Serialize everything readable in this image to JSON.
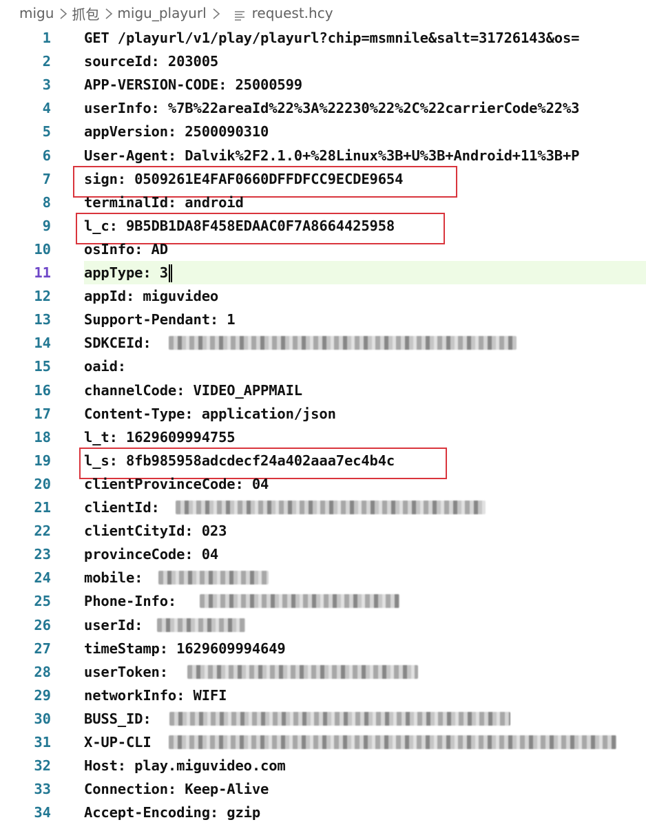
{
  "breadcrumb": {
    "items": [
      "migu",
      "抓包",
      "migu_playurl"
    ],
    "file": "request.hcy",
    "icons": [
      "chevron-right-icon",
      "file-lines-icon"
    ]
  },
  "editor": {
    "active_line": 11,
    "highlight_color": "#d9343c",
    "lines": [
      {
        "n": "1",
        "text": "GET /playurl/v1/play/playurl?chip=msmnile&salt=31726143&os="
      },
      {
        "n": "2",
        "text": "sourceId: 203005"
      },
      {
        "n": "3",
        "text": "APP-VERSION-CODE: 25000599"
      },
      {
        "n": "4",
        "text": "userInfo: %7B%22areaId%22%3A%22230%22%2C%22carrierCode%22%3"
      },
      {
        "n": "5",
        "text": "appVersion: 2500090310"
      },
      {
        "n": "6",
        "text": "User-Agent: Dalvik%2F2.1.0+%28Linux%3B+U%3B+Android+11%3B+P"
      },
      {
        "n": "7",
        "text": "sign: 0509261E4FAF0660DFFDFCC9ECDE9654"
      },
      {
        "n": "8",
        "text": "terminalId: android"
      },
      {
        "n": "9",
        "text": "l_c: 9B5DB1DA8F458EDAAC0F7A8664425958"
      },
      {
        "n": "10",
        "text": "osInfo: AD"
      },
      {
        "n": "11",
        "text": "appType: 3"
      },
      {
        "n": "12",
        "text": "appId: miguvideo"
      },
      {
        "n": "13",
        "text": "Support-Pendant: 1"
      },
      {
        "n": "14",
        "text": "SDKCEId:"
      },
      {
        "n": "15",
        "text": "oaid:"
      },
      {
        "n": "16",
        "text": "channelCode: VIDEO_APPMAIL"
      },
      {
        "n": "17",
        "text": "Content-Type: application/json"
      },
      {
        "n": "18",
        "text": "l_t: 1629609994755"
      },
      {
        "n": "19",
        "text": "l_s: 8fb985958adcdecf24a402aaa7ec4b4c"
      },
      {
        "n": "20",
        "text": "clientProvinceCode: 04"
      },
      {
        "n": "21",
        "text": "clientId:"
      },
      {
        "n": "22",
        "text": "clientCityId: 023"
      },
      {
        "n": "23",
        "text": "provinceCode: 04"
      },
      {
        "n": "24",
        "text": "mobile:"
      },
      {
        "n": "25",
        "text": "Phone-Info:"
      },
      {
        "n": "26",
        "text": "userId:"
      },
      {
        "n": "27",
        "text": "timeStamp: 1629609994649"
      },
      {
        "n": "28",
        "text": "userToken:"
      },
      {
        "n": "29",
        "text": "networkInfo: WIFI"
      },
      {
        "n": "30",
        "text": "BUSS_ID:"
      },
      {
        "n": "31",
        "text": "X-UP-CLI"
      },
      {
        "n": "32",
        "text": "Host: play.miguvideo.com"
      },
      {
        "n": "33",
        "text": "Connection: Keep-Alive"
      },
      {
        "n": "34",
        "text": "Accept-Encoding: gzip"
      }
    ]
  }
}
